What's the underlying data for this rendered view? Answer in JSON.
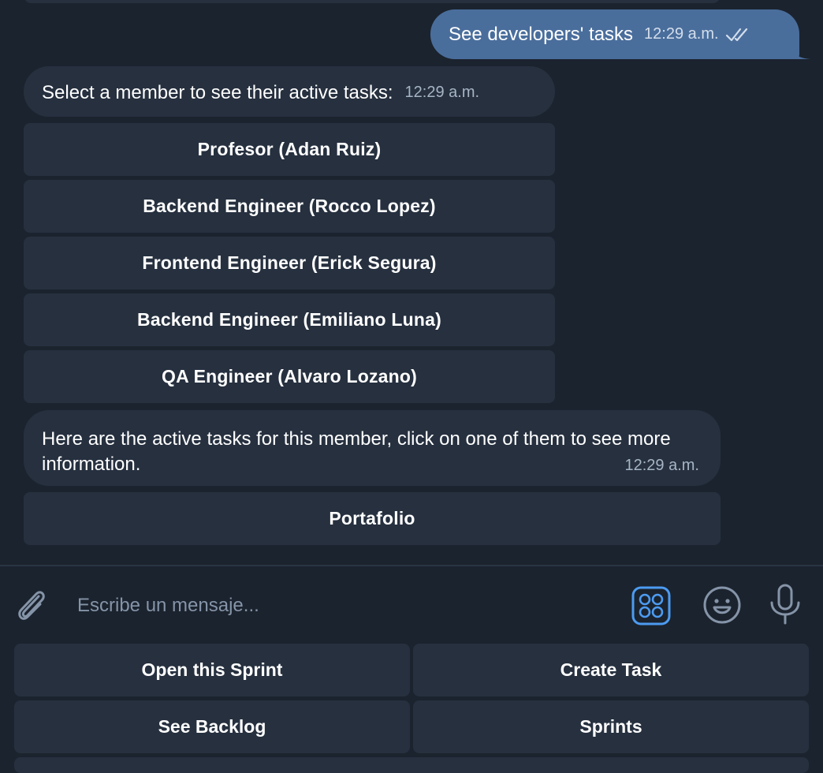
{
  "messages": {
    "outgoing": {
      "text": "See developers' tasks",
      "time": "12:29 a.m."
    },
    "prompt": {
      "text": "Select a member to see their active tasks:",
      "time": "12:29 a.m."
    },
    "members": [
      "Profesor (Adan Ruiz)",
      "Backend Engineer (Rocco Lopez)",
      "Frontend Engineer (Erick Segura)",
      "Backend Engineer (Emiliano Luna)",
      "QA Engineer (Alvaro Lozano)"
    ],
    "tasks_intro": {
      "text": "Here are the active tasks for this member, click on one of them to see more information.",
      "time": "12:29 a.m."
    },
    "tasks": [
      "Portafolio"
    ]
  },
  "composer": {
    "placeholder": "Escribe un mensaje..."
  },
  "reply_keyboard": [
    "Open this Sprint",
    "Create Task",
    "See Backlog",
    "Sprints"
  ],
  "colors": {
    "background": "#1b232e",
    "incoming_bubble": "#26303f",
    "outgoing_bubble": "#4a6e9c",
    "accent": "#4c9bf1"
  }
}
